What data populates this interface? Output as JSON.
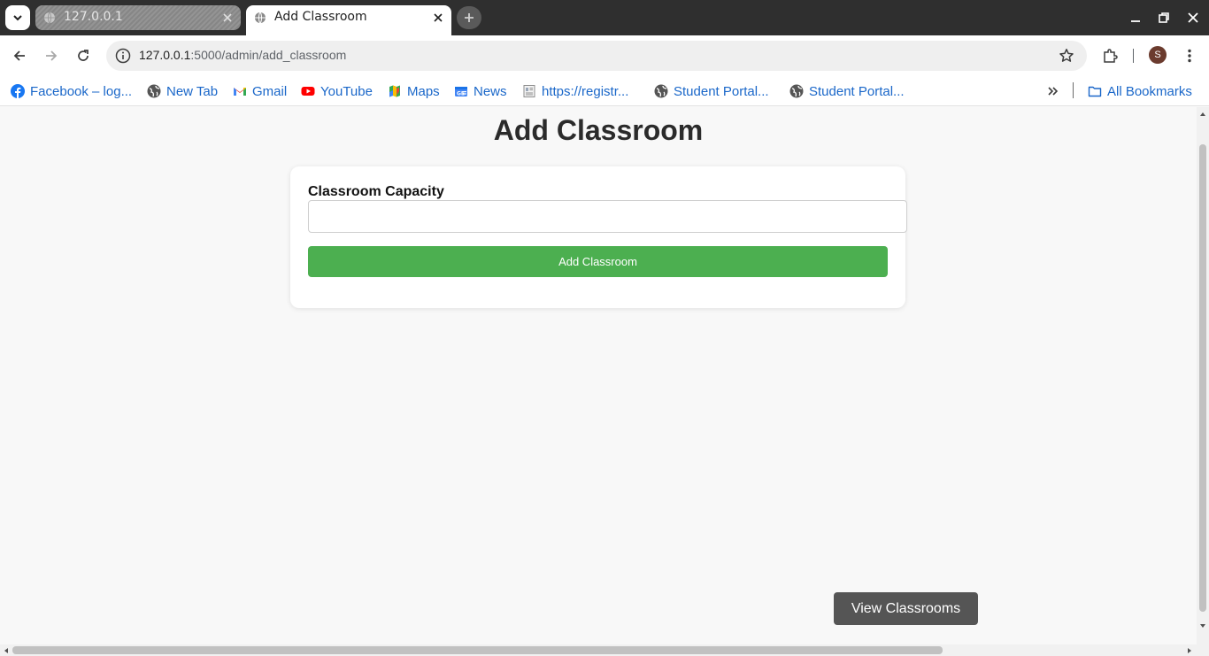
{
  "browser": {
    "tabs": [
      {
        "title": "127.0.0.1",
        "active": false
      },
      {
        "title": "Add Classroom",
        "active": true
      }
    ],
    "address": {
      "host": "127.0.0.1",
      "path": ":5000/admin/add_classroom"
    },
    "profile_initial": "S",
    "bookmarks": [
      {
        "label": "Facebook – log...",
        "icon": "facebook-icon"
      },
      {
        "label": "New Tab",
        "icon": "globe-icon"
      },
      {
        "label": "Gmail",
        "icon": "gmail-icon"
      },
      {
        "label": "YouTube",
        "icon": "youtube-icon"
      },
      {
        "label": "Maps",
        "icon": "maps-icon"
      },
      {
        "label": "News",
        "icon": "news-icon"
      },
      {
        "label": "https://registr...",
        "icon": "document-icon"
      },
      {
        "label": "Student Portal...",
        "icon": "globe-icon"
      },
      {
        "label": "Student Portal...",
        "icon": "globe-icon"
      }
    ],
    "all_bookmarks_label": "All Bookmarks"
  },
  "page": {
    "title": "Add Classroom",
    "form": {
      "capacity_label": "Classroom Capacity",
      "capacity_value": "",
      "submit_label": "Add Classroom"
    },
    "view_button_label": "View Classrooms"
  },
  "colors": {
    "submit_button": "#4caf50",
    "view_button": "#555555",
    "bookmark_text": "#1a67c9"
  }
}
